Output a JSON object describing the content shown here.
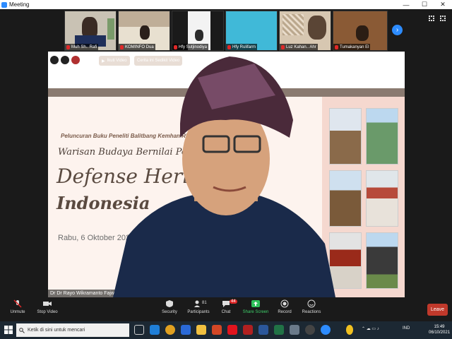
{
  "window": {
    "title": "Meeting",
    "minimize": "—",
    "maximize": "☐",
    "close": "✕"
  },
  "thumbnails": [
    {
      "name": "Muh Sh.. Rafi"
    },
    {
      "name": "KOMINFO Dua"
    },
    {
      "name": "Hfy Sutjinodiya"
    },
    {
      "name": "Hfy Rulifarm"
    },
    {
      "name": "Luz Kahan.. Ahr"
    },
    {
      "name": "Tumakanyan El"
    }
  ],
  "slide": {
    "btn_join": "Ikuti Video",
    "btn_seedling": "Cerita ini Sedikit Video",
    "subtitle": "Peluncuran Buku Peneliti Balitbang Kemhan RI :",
    "tagline": "Warisan Budaya Bernilai Pertahanan",
    "title_line1": "Defense Heritage",
    "title_line2": "Indonesia",
    "date": "Rabu, 6 Oktober 2021"
  },
  "speaker": {
    "name": "Dr Dr Rayo Wikramanto Fajwaz Dwiadi"
  },
  "toolbar": {
    "unmute": "Unmute",
    "stop_video": "Stop Video",
    "security": "Security",
    "participants": "Participants",
    "participants_count": "81",
    "chat": "Chat",
    "chat_badge": "44",
    "share_screen": "Share Screen",
    "record": "Record",
    "reactions": "Reactions",
    "leave": "Leave"
  },
  "taskbar": {
    "search_placeholder": "Ketik di sini untuk mencari",
    "lang": "IND",
    "time": "15:49",
    "date": "06/10/2021"
  },
  "colors": {
    "accent": "#2d8cff",
    "leave": "#c0392b",
    "slide_bg": "#fdf3ee"
  }
}
